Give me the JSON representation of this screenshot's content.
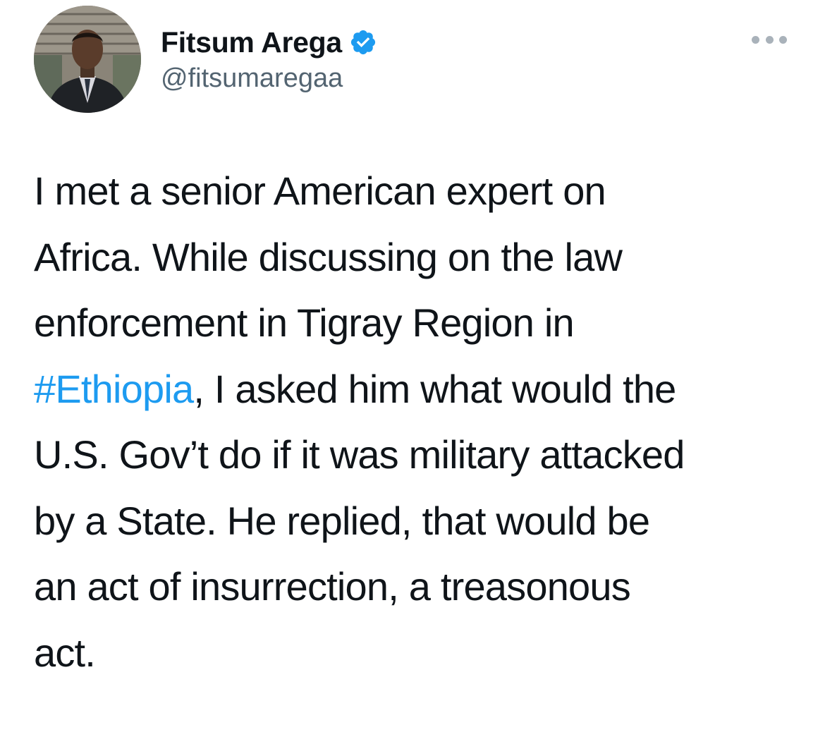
{
  "author": {
    "display_name": "Fitsum Arega",
    "handle": "@fitsumaregaa",
    "verified": true,
    "avatar_icon": "profile-photo",
    "verified_icon": "verified-badge-icon",
    "verified_color": "#1d9bf0"
  },
  "menu": {
    "icon": "more-options-icon"
  },
  "tweet": {
    "lines": [
      "I met a senior American expert on",
      "Africa. While discussing on the law",
      "enforcement in Tigray Region in"
    ],
    "hashtag": "#Ethiopia",
    "after_hashtag": ", I asked him what would the",
    "lines_after": [
      "U.S. Gov’t do if it was military attacked",
      "by a State. He replied, that would be",
      "an act of insurrection, a treasonous",
      "act."
    ]
  },
  "colors": {
    "text": "#0f1419",
    "secondary_text": "#536471",
    "link": "#1d9bf0"
  }
}
